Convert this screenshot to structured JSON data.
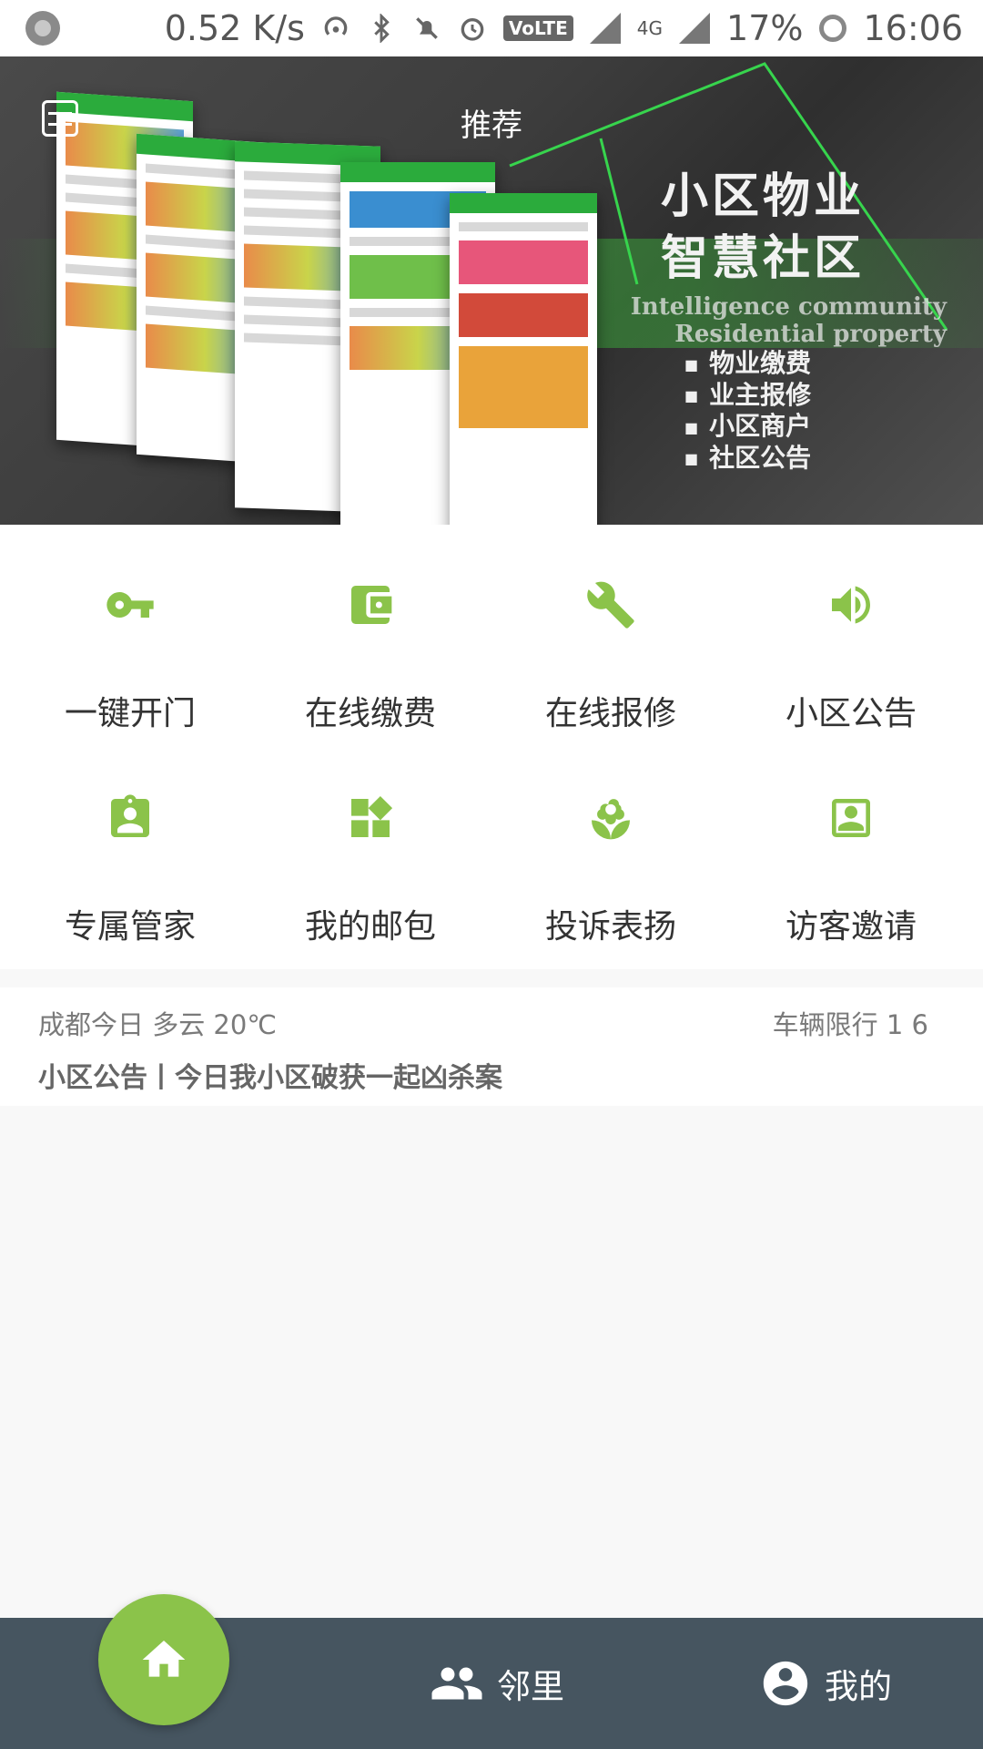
{
  "status_bar": {
    "speed": "0.52 K/s",
    "volte": "VoLTE",
    "network": "4G",
    "battery": "17%",
    "time": "16:06"
  },
  "banner": {
    "tab_label": "推荐",
    "title_line1": "小区物业",
    "title_line2": "智慧社区",
    "en_line1": "Intelligence community",
    "en_line2": "Residential property",
    "features": [
      "物业缴费",
      "业主报修",
      "小区商户",
      "社区公告"
    ],
    "accent_color": "#37d44d"
  },
  "services": [
    {
      "label": "一键开门",
      "icon": "key-icon"
    },
    {
      "label": "在线缴费",
      "icon": "wallet-icon"
    },
    {
      "label": "在线报修",
      "icon": "wrench-icon"
    },
    {
      "label": "小区公告",
      "icon": "speaker-icon"
    },
    {
      "label": "专属管家",
      "icon": "badge-icon"
    },
    {
      "label": "我的邮包",
      "icon": "widgets-icon"
    },
    {
      "label": "投诉表扬",
      "icon": "flower-icon"
    },
    {
      "label": "访客邀请",
      "icon": "portrait-icon"
    }
  ],
  "info": {
    "weather": "成都今日  多云  20℃",
    "traffic": "车辆限行 1 6",
    "notice": "小区公告丨今日我小区破获一起凶杀案"
  },
  "bottom_nav": {
    "neighbors_label": "邻里",
    "mine_label": "我的",
    "home_color": "#8bc34a",
    "bar_color": "#465560"
  },
  "theme": {
    "icon_green": "#8bc34a"
  }
}
